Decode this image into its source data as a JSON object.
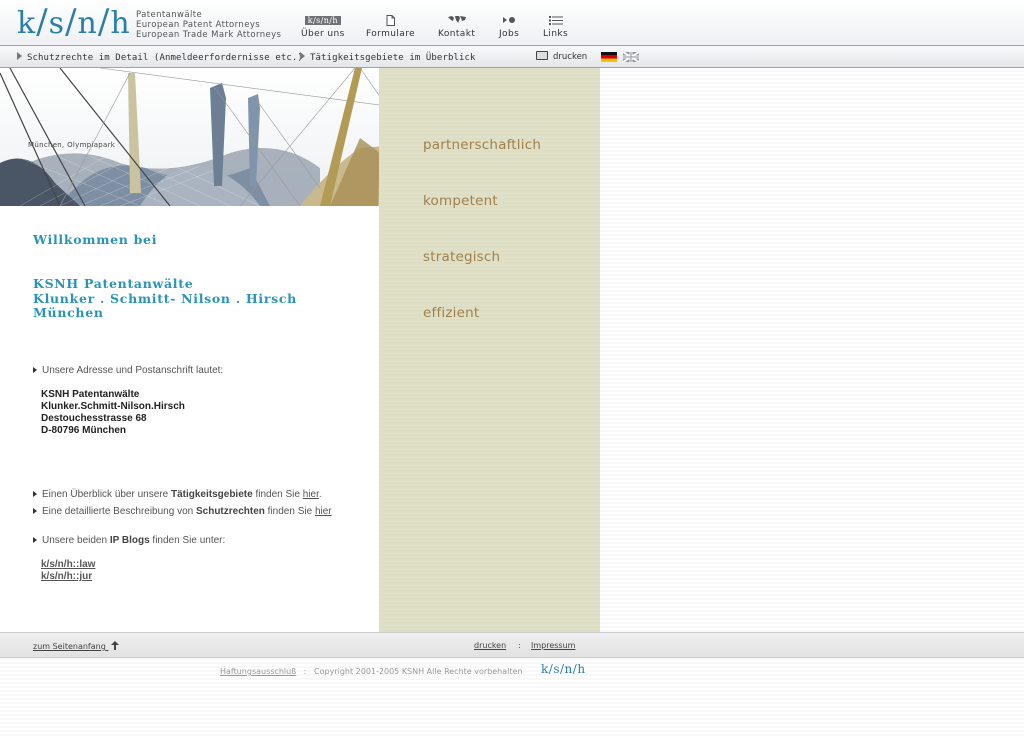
{
  "header": {
    "logo": {
      "k": "k",
      "s": "s",
      "n": "n",
      "h": "h"
    },
    "tagline": [
      "Patentanwälte",
      "European Patent Attorneys",
      "European Trade Mark Attorneys"
    ],
    "nav": [
      {
        "label": "Über uns",
        "icon": "ksnh-mini-logo",
        "icon_text": "k/s/n/h"
      },
      {
        "label": "Formulare",
        "icon": "document-icon"
      },
      {
        "label": "Kontakt",
        "icon": "world-map-icon"
      },
      {
        "label": "Jobs",
        "icon": "play-dot-icon"
      },
      {
        "label": "Links",
        "icon": "list-icon"
      }
    ]
  },
  "subnav": {
    "detail": "Schutzrechte im Detail (Anmeldeerfordernisse etc.)",
    "overview": "Tätigkeitsgebiete im Überblick",
    "print": "drucken",
    "flags": [
      "de",
      "gb"
    ]
  },
  "hero": {
    "caption": "München, Olympiapark"
  },
  "content": {
    "welcome": "Willkommen bei",
    "firm": [
      "KSNH Patentanwälte",
      "Klunker . Schmitt- Nilson . Hirsch",
      "München"
    ],
    "address_intro": "Unsere Adresse und Postanschrift lautet:",
    "address": [
      "KSNH Patentanwälte",
      "Klunker.Schmitt-Nilson.Hirsch",
      "Destouchesstrasse 68",
      "D-80796 München"
    ],
    "line1": {
      "pre": "Einen Überblick über unsere ",
      "bold": "Tätigkeitsgebiete",
      "mid": " finden Sie ",
      "link": "hier",
      "post": "."
    },
    "line2": {
      "pre": "Eine detaillierte Beschreibung von ",
      "bold": "Schutzrechten",
      "mid": " finden Sie ",
      "link": "hier"
    },
    "line3": {
      "pre": "Unsere beiden ",
      "bold": "IP Blogs",
      "post": " finden Sie unter:"
    },
    "blogs": [
      "k/s/n/h::law",
      "k/s/n/h::jur"
    ]
  },
  "panel": {
    "mottos": [
      "partnerschaftlich",
      "kompetent",
      "strategisch",
      "effizient"
    ]
  },
  "footer": {
    "top": "zum Seitenanfang",
    "print": "drucken",
    "sep": ":",
    "imprint": "Impressum",
    "disclaimer": "Haftungsausschluß",
    "copyright": "Copyright 2001-2005 KSNH Alle Rechte vorbehalten"
  },
  "colors": {
    "accent": "#2a94b5",
    "motto": "#a0804c",
    "panel": "#e0e0c8"
  }
}
